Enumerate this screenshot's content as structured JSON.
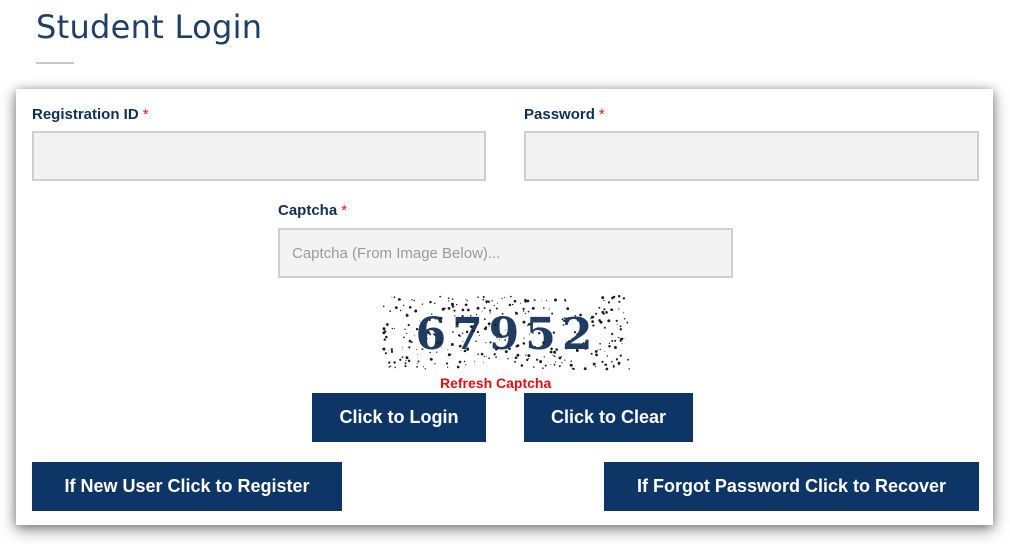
{
  "page": {
    "title": "Student Login"
  },
  "form": {
    "registration_id": {
      "label": "Registration ID",
      "required_mark": "*",
      "value": "",
      "placeholder": ""
    },
    "password": {
      "label": "Password",
      "required_mark": "*",
      "value": "",
      "placeholder": ""
    },
    "captcha": {
      "label": "Captcha",
      "required_mark": "*",
      "value": "",
      "placeholder": "Captcha (From Image Below)..."
    },
    "captcha_image": {
      "text": "67952"
    },
    "refresh_label": "Refresh Captcha"
  },
  "buttons": {
    "login": "Click to Login",
    "clear": "Click to Clear",
    "register": "If New User Click to Register",
    "recover": "If Forgot Password Click to Recover"
  },
  "colors": {
    "title": "#1e3f66",
    "label": "#0f2f55",
    "required": "#d21a1a",
    "button_bg": "#0d3566",
    "refresh": "#e01010"
  }
}
